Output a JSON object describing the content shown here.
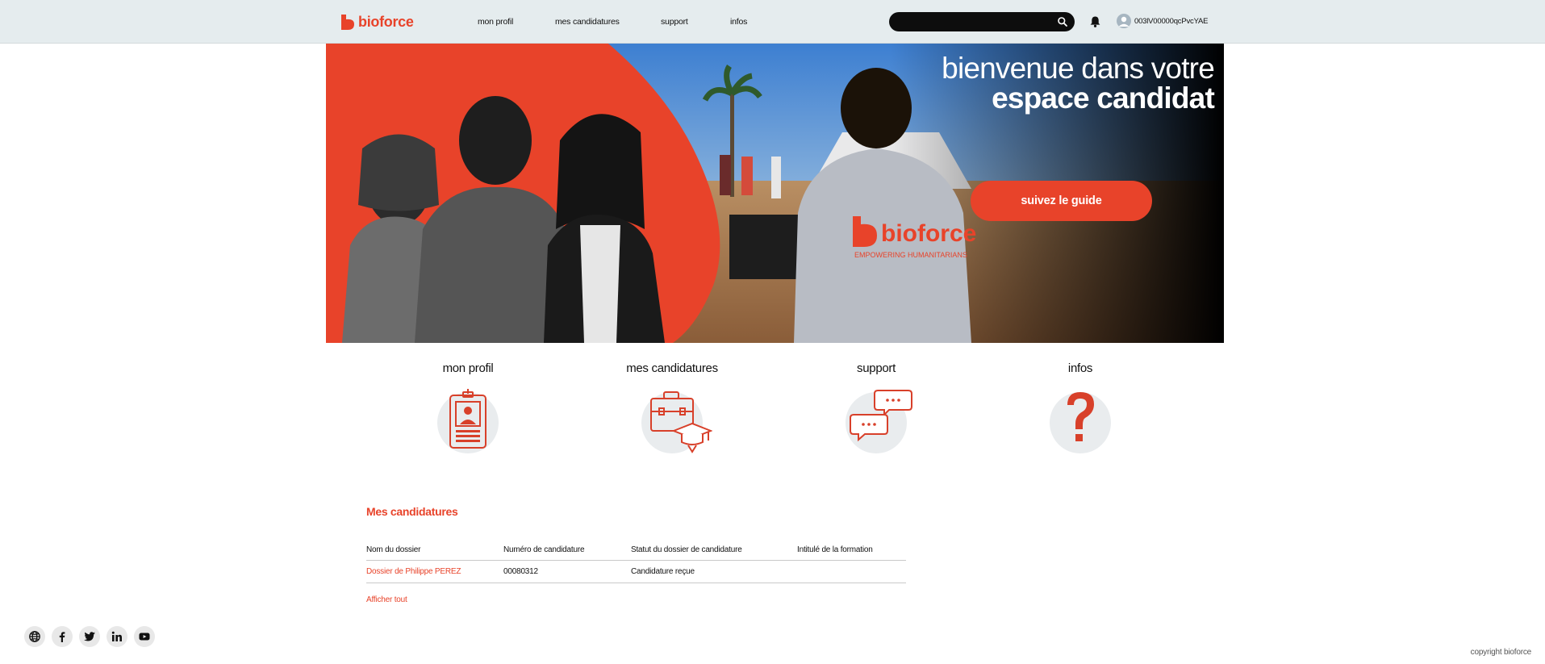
{
  "brand": {
    "name": "bioforce",
    "accent": "#e8432a"
  },
  "nav": {
    "items": [
      {
        "label": "mon profil"
      },
      {
        "label": "mes candidatures"
      },
      {
        "label": "support"
      },
      {
        "label": "infos"
      }
    ]
  },
  "search": {
    "value": "",
    "placeholder": ""
  },
  "user": {
    "name": "003lV00000qcPvcYAE"
  },
  "hero": {
    "title_line1": "bienvenue dans votre",
    "title_line2": "espace candidat",
    "button_label": "suivez le guide",
    "shirt_brand": "bioforce",
    "shirt_tagline": "EMPOWERING HUMANITARIANS"
  },
  "tiles": [
    {
      "label": "mon profil",
      "icon": "id-badge-icon"
    },
    {
      "label": "mes candidatures",
      "icon": "briefcase-graduation-icon"
    },
    {
      "label": "support",
      "icon": "chat-bubbles-icon"
    },
    {
      "label": "infos",
      "icon": "question-mark-icon"
    }
  ],
  "applications": {
    "title": "Mes candidatures",
    "columns": [
      "Nom du dossier",
      "Numéro de candidature",
      "Statut du dossier de candidature",
      "Intitulé de la formation"
    ],
    "rows": [
      {
        "name": "Dossier de Philippe PEREZ",
        "number": "00080312",
        "status": "Candidature reçue",
        "training": ""
      }
    ],
    "show_all_label": "Afficher tout"
  },
  "footer": {
    "social": [
      "globe-icon",
      "facebook-icon",
      "twitter-icon",
      "linkedin-icon",
      "youtube-icon"
    ],
    "copyright": "copyright bioforce"
  }
}
